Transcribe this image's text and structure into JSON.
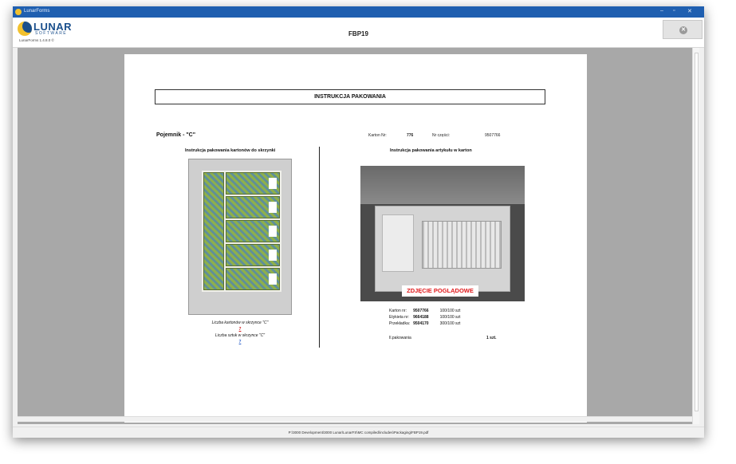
{
  "window": {
    "app_title": "LunarForms",
    "controls": [
      "–",
      "▫",
      "✕"
    ]
  },
  "header": {
    "logo_brand": "LUNAR",
    "logo_sub": "SOFTWARE",
    "version": "LunarForms 1.4.8.0 ©",
    "doc_title": "FBP19",
    "close_icon": "close-circle-icon"
  },
  "document": {
    "title": "INSTRUKCJA PAKOWANIA",
    "container_label": "Pojemnik - \"C\"",
    "karton_label": "Karton Nr:",
    "karton_value": "776",
    "part_label": "Nr części:",
    "part_value": "9507766",
    "left_heading": "Instrukcja pakowania kartonów do skrzynki",
    "right_heading": "Instrukcja pakowania artykułu w karton",
    "cartons_label": "Liczba kartonów w skrzynce \"C\"",
    "cartons_value": "7",
    "pieces_label": "Liczba sztuk w skrzynce \"C\"",
    "pieces_value": "7",
    "photo_badge": "ZDJĘCIE POGLĄDOWE",
    "specs": [
      {
        "label": "Karton nr:",
        "value": "9507766",
        "qty": "100/100 szt"
      },
      {
        "label": "Etykieta nr:",
        "value": "9664188",
        "qty": "100/100 szt"
      },
      {
        "label": "Przekładka:",
        "value": "9504170",
        "qty": "300/100 szt"
      }
    ],
    "pack_label": "Il.pakowania",
    "pack_value": "1 szt."
  },
  "status": {
    "path": "P:\\3000 Development\\3000 Lunar\\LunarFS\\MC compiled\\includes\\Packaging\\FBP19.pdf"
  }
}
